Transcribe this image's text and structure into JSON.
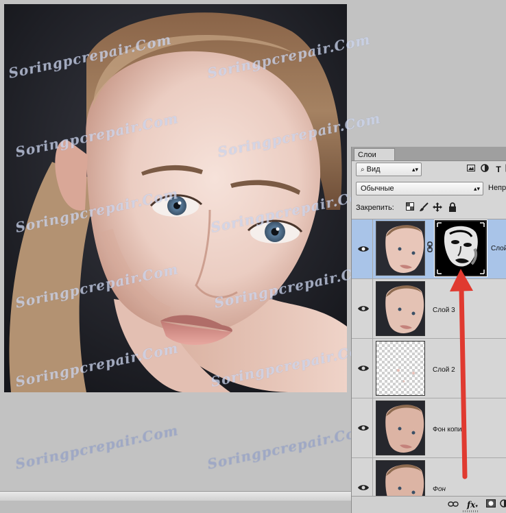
{
  "watermark": "Soringpcrepair.Com",
  "layers_panel": {
    "tab_label": "Слои",
    "filter_label": "Вид",
    "blend_mode": "Обычные",
    "opacity_label": "Непро",
    "lock_label": "Закрепить:",
    "layers": [
      {
        "name": "Слой",
        "selected": true,
        "has_mask": true,
        "visible": true
      },
      {
        "name": "Слой 3",
        "selected": false,
        "has_mask": false,
        "visible": true
      },
      {
        "name": "Слой 2",
        "selected": false,
        "has_mask": false,
        "visible": true
      },
      {
        "name": "Фон копи",
        "selected": false,
        "has_mask": false,
        "visible": true
      },
      {
        "name": "Фон",
        "selected": false,
        "has_mask": false,
        "visible": true
      }
    ],
    "bottom_icons": [
      "link-icon",
      "fx-icon",
      "mask-icon",
      "adjustment-icon"
    ]
  },
  "colors": {
    "selected_layer": "#a9c4e8",
    "arrow": "#e03a30",
    "photo_background": "#202024"
  }
}
